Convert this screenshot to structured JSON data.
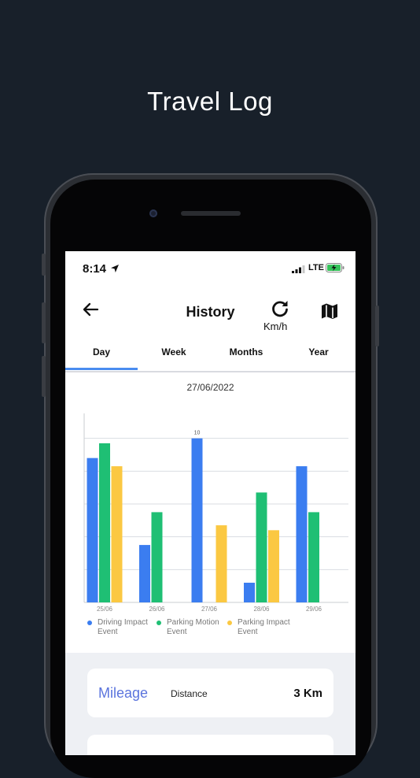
{
  "headline": "Travel Log",
  "status_bar": {
    "time": "8:14",
    "network": "LTE"
  },
  "nav": {
    "title": "History",
    "unit_label": "Km/h"
  },
  "tabs": [
    {
      "label": "Day",
      "active": true
    },
    {
      "label": "Week",
      "active": false
    },
    {
      "label": "Months",
      "active": false
    },
    {
      "label": "Year",
      "active": false
    }
  ],
  "date_label": "27/06/2022",
  "colors": {
    "blue": "#3b7df0",
    "green": "#1fbf74",
    "yellow": "#fbc842",
    "accent": "#4a8cf0"
  },
  "chart_data": {
    "type": "bar",
    "categories": [
      "25/06",
      "26/06",
      "27/06",
      "28/06",
      "29/06"
    ],
    "ylim": [
      0,
      12
    ],
    "grid": true,
    "legend_position": "bottom",
    "series": [
      {
        "name": "Driving Impact Event",
        "color": "#3b7df0",
        "values": [
          8.8,
          3.5,
          10,
          1.2,
          8.3
        ]
      },
      {
        "name": "Parking Motion Event",
        "color": "#1fbf74",
        "values": [
          9.7,
          5.5,
          0,
          6.7,
          5.5
        ]
      },
      {
        "name": "Parking Impact Event",
        "color": "#fbc842",
        "values": [
          8.3,
          0,
          4.7,
          4.4,
          0
        ]
      }
    ],
    "data_labels": [
      {
        "category": "27/06",
        "series": "Driving Impact Event",
        "text": "10"
      }
    ]
  },
  "summary": {
    "title": "Mileage",
    "label": "Distance",
    "value": "3 Km"
  }
}
